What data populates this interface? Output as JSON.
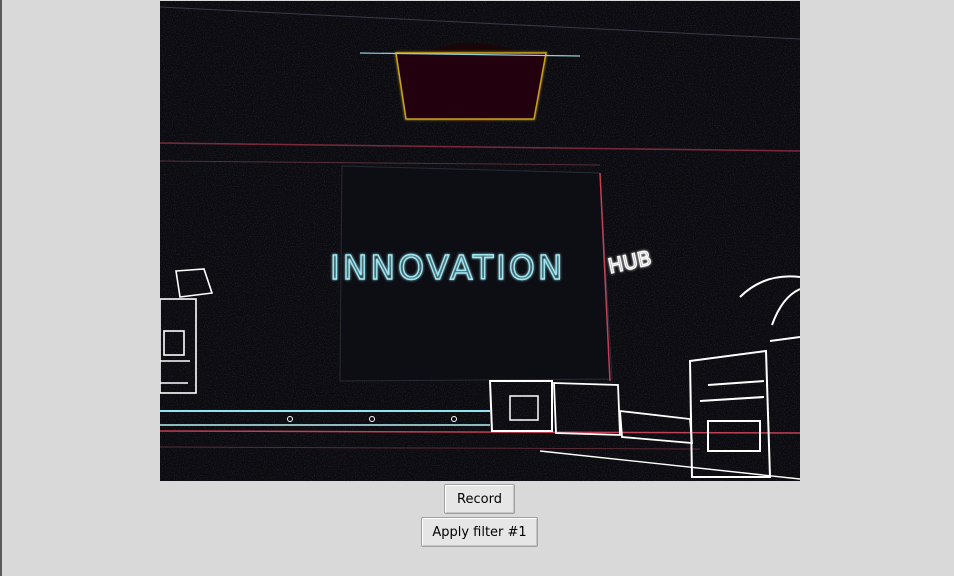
{
  "video": {
    "sign_main_text": "INNOVATION",
    "sign_sub_text": "HUB"
  },
  "controls": {
    "record_label": "Record",
    "filter_label": "Apply filter #1"
  },
  "colors": {
    "window_bg": "#d9d9d9",
    "video_bg": "#0b0b10",
    "edge_cyan": "#8fe6ee",
    "edge_white": "#ffffff",
    "edge_red": "#b03040"
  }
}
